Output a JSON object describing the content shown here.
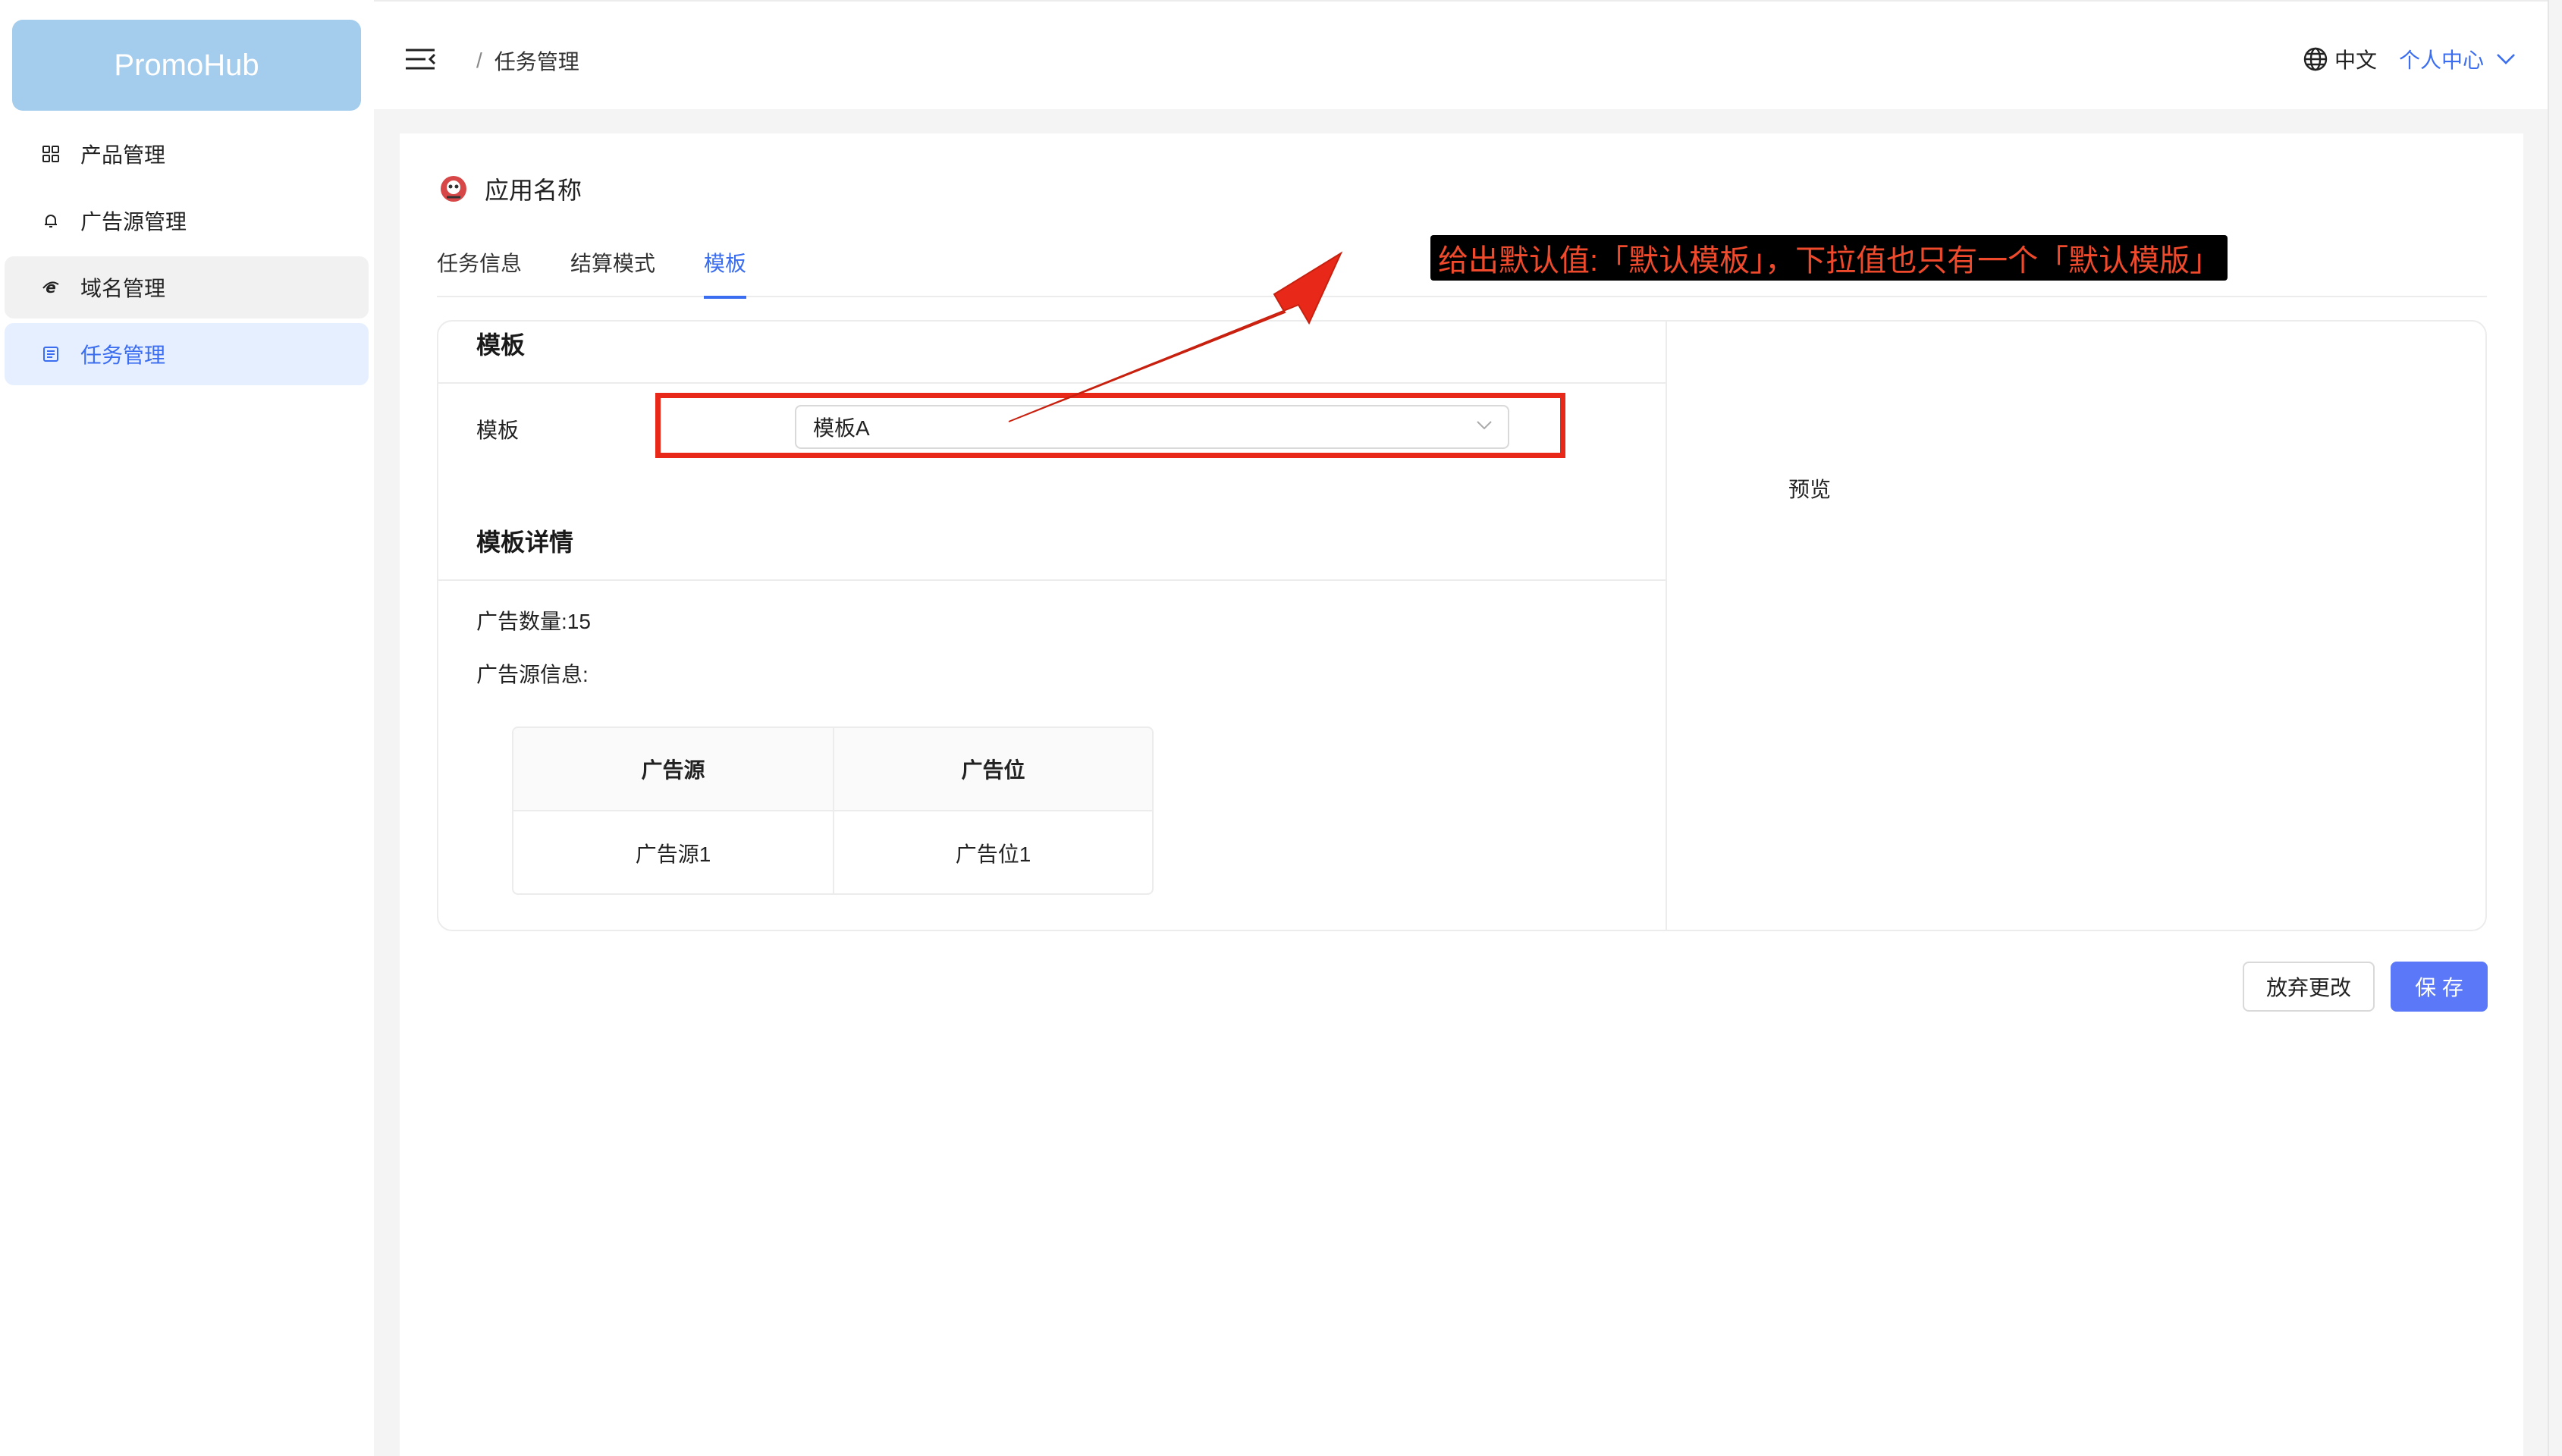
{
  "sidebar": {
    "logo": "PromoHub",
    "items": [
      {
        "label": "产品管理",
        "icon": "grid-icon"
      },
      {
        "label": "广告源管理",
        "icon": "bell-icon"
      },
      {
        "label": "域名管理",
        "icon": "ie-icon"
      },
      {
        "label": "任务管理",
        "icon": "list-icon"
      }
    ],
    "active_item": "任务管理"
  },
  "header": {
    "breadcrumb": [
      "任务管理"
    ],
    "language": "中文",
    "user_menu": "个人中心"
  },
  "app": {
    "name": "应用名称"
  },
  "tabs": [
    {
      "label": "任务信息"
    },
    {
      "label": "结算模式"
    },
    {
      "label": "模板",
      "active": true
    }
  ],
  "template_section": {
    "title": "模板",
    "field_label": "模板",
    "select_value": "模板A"
  },
  "details_section": {
    "title": "模板详情",
    "ad_count": "广告数量:15",
    "ad_source_info": "广告源信息:",
    "table": {
      "columns": [
        "广告源",
        "广告位"
      ],
      "rows": [
        [
          "广告源1",
          "广告位1"
        ]
      ]
    }
  },
  "preview": {
    "label": "预览"
  },
  "actions": {
    "discard": "放弃更改",
    "save": "保 存"
  },
  "annotation": {
    "note": "给出默认值:「默认模板」，下拉值也只有一个「默认模版」",
    "color": "#e8291a"
  },
  "colors": {
    "primary": "#3a6df0",
    "save_button": "#5a78f8",
    "logo_bg": "#a4ccec",
    "annotation": "#e8291a"
  }
}
